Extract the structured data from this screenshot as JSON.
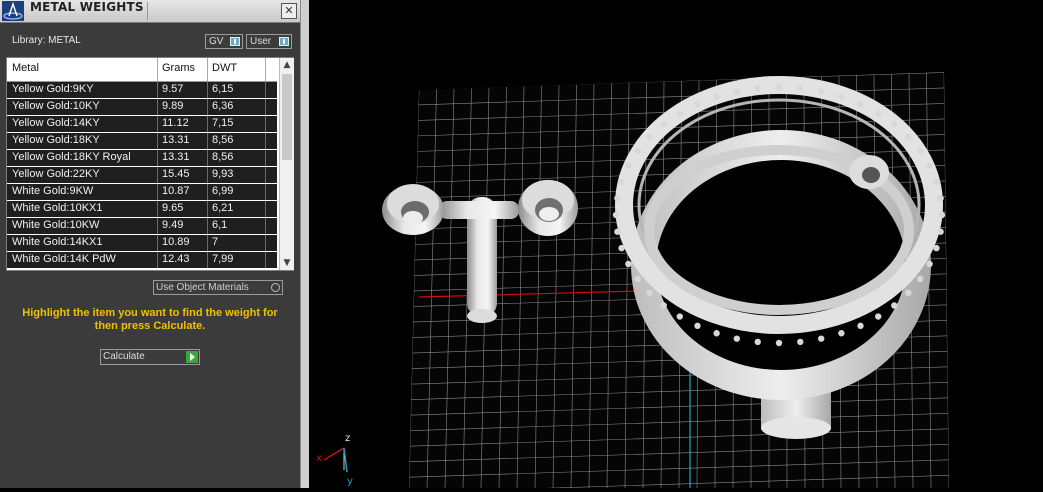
{
  "titlebar": {
    "title": "METAL WEIGHTS",
    "close_glyph": "✕"
  },
  "library": {
    "label": "Library: METAL"
  },
  "toggles": {
    "gv": "GV",
    "user": "User"
  },
  "table": {
    "columns": [
      "Metal",
      "Grams",
      "DWT"
    ],
    "rows": [
      [
        "Yellow Gold:9KY",
        "9.57",
        "6,15"
      ],
      [
        "Yellow Gold:10KY",
        "9.89",
        "6,36"
      ],
      [
        "Yellow Gold:14KY",
        "11.12",
        "7,15"
      ],
      [
        "Yellow Gold:18KY",
        "13.31",
        "8,56"
      ],
      [
        "Yellow Gold:18KY Royal",
        "13.31",
        "8,56"
      ],
      [
        "Yellow Gold:22KY",
        "15.45",
        "9,93"
      ],
      [
        "White Gold:9KW",
        "10.87",
        "6,99"
      ],
      [
        "White Gold:10KX1",
        "9.65",
        "6,21"
      ],
      [
        "White Gold:10KW",
        "9.49",
        "6,1"
      ],
      [
        "White Gold:14KX1",
        "10.89",
        "7"
      ],
      [
        "White Gold:14K PdW",
        "12.43",
        "7,99"
      ]
    ]
  },
  "options": {
    "use_object_materials": "Use Object Materials"
  },
  "instructions": "Highlight the item you want to find the weight for then press Calculate.",
  "calculate": {
    "label": "Calculate"
  },
  "viewport": {
    "axis_x": "x",
    "axis_y": "y",
    "axis_z": "z"
  },
  "colors": {
    "instruction": "#f0c000",
    "calc_accent": "#3aa83a",
    "x_axis": "#d01010",
    "y_axis": "#1aa6c8",
    "grid": "#8a8a8a"
  }
}
